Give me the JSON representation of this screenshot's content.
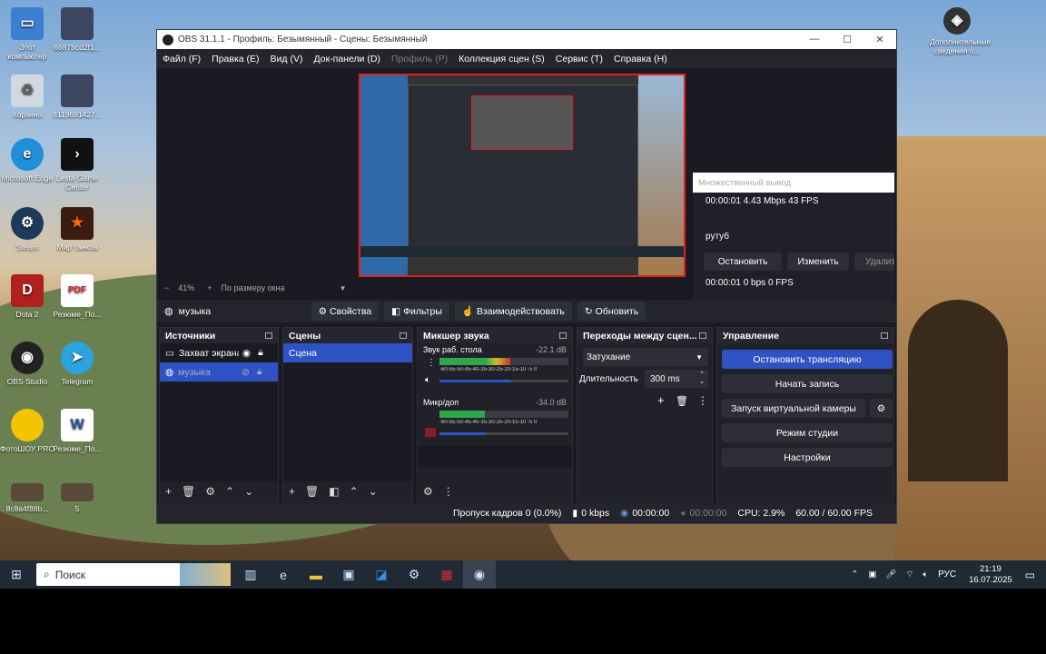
{
  "desktop": {
    "icons": [
      {
        "label": "Этот компьютер"
      },
      {
        "label": "6687bcd2f1..."
      },
      {
        "label": "Корзина"
      },
      {
        "label": "8119691427..."
      },
      {
        "label": "Microsoft Edge"
      },
      {
        "label": "Lesta Game Center"
      },
      {
        "label": "Steam"
      },
      {
        "label": "Мир танков"
      },
      {
        "label": "Dota 2"
      },
      {
        "label": "Резюме_По..."
      },
      {
        "label": "OBS Studio"
      },
      {
        "label": "Telegram"
      },
      {
        "label": "ФотоШОУ PRO"
      },
      {
        "label": "Резюме_По..."
      },
      {
        "label": "8c8a4f88b..."
      },
      {
        "label": "5"
      },
      {
        "label": "Дополнительные сведения о..."
      }
    ]
  },
  "obs": {
    "title": "OBS 31.1.1 - Профиль: Безымянный - Сцены: Безымянный",
    "menu": [
      "Файл (F)",
      "Правка (E)",
      "Вид (V)",
      "Док-панели (D)",
      "Профиль (P)",
      "Коллекция сцен (S)",
      "Сервис (T)",
      "Справка (H)"
    ],
    "zoom": "41%",
    "zoom_plus": "+",
    "zoom_minus": "−",
    "zoom_mode": "По размеру окна",
    "multi_output": {
      "title": "Множественный вывод",
      "line1": "00:00:01  4.43 Mbps  43 FPS",
      "target_name": "рутуб",
      "stop": "Остановить",
      "edit": "Изменить",
      "delete": "Удалить",
      "line2": "00:00:01  0 bps  0 FPS"
    },
    "source_toolbar": {
      "source": "музыка",
      "properties": "Свойства",
      "filters": "Фильтры",
      "interact": "Взаимодействовать",
      "refresh": "Обновить"
    },
    "sources": {
      "title": "Источники",
      "items": [
        "Захват экрана",
        "музыка"
      ]
    },
    "scenes": {
      "title": "Сцены",
      "items": [
        "Сцена"
      ]
    },
    "mixer": {
      "title": "Микшер звука",
      "channels": [
        {
          "name": "Звук раб. стола",
          "db": "-22.1 dB",
          "level": 0.55
        },
        {
          "name": "Микр/доп",
          "db": "-34.0 dB",
          "level": 0.35
        }
      ],
      "scale": "-60-55-50-45-40-35-30-25-20-15-10 -5  0"
    },
    "transitions": {
      "title": "Переходы между сцен...",
      "type": "Затухание",
      "duration_label": "Длительность",
      "duration": "300 ms"
    },
    "controls": {
      "title": "Управление",
      "stop_stream": "Остановить трансляцию",
      "start_record": "Начать запись",
      "virtual_cam": "Запуск виртуальной камеры",
      "studio_mode": "Режим студии",
      "settings": "Настройки"
    },
    "status": {
      "dropped": "Пропуск кадров 0 (0.0%)",
      "kbps": "0 kbps",
      "stream_time": "00:00:00",
      "rec_time": "00:00:00",
      "cpu": "CPU: 2.9%",
      "fps": "60.00 / 60.00 FPS"
    }
  },
  "taskbar": {
    "search_placeholder": "Поиск",
    "lang": "РУС",
    "time": "21:19",
    "date": "16.07.2025"
  },
  "colors": {
    "accent": "#2f53c4",
    "record_red": "#e02020"
  }
}
